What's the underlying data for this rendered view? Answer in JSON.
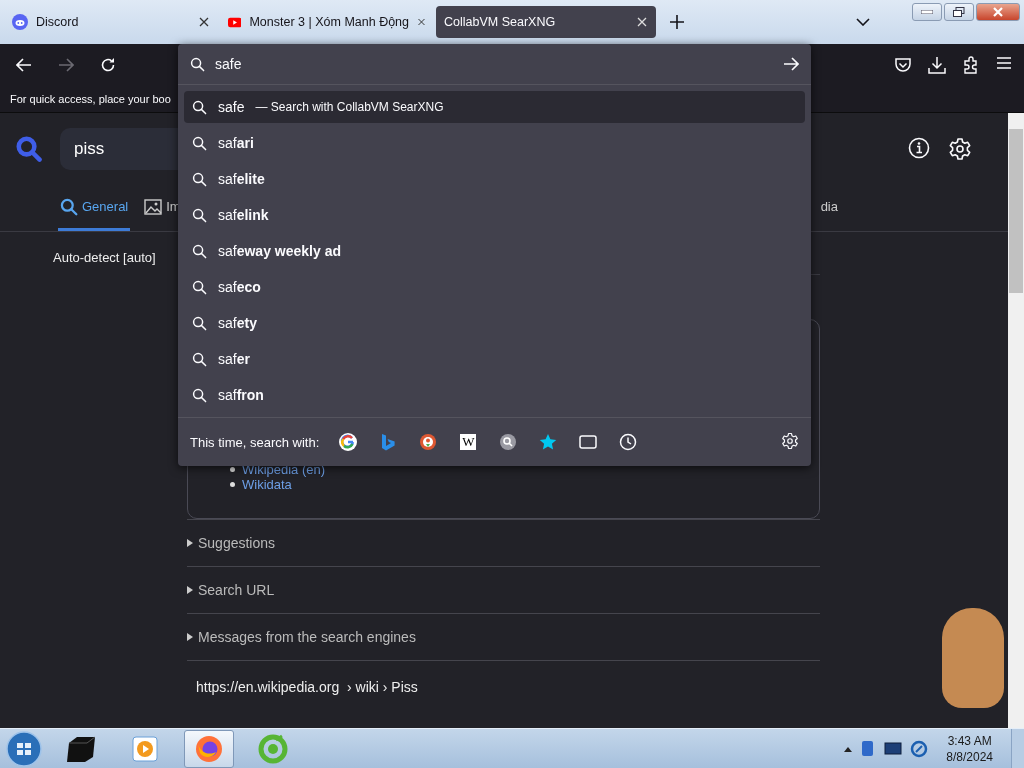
{
  "browser_tabs": [
    {
      "kind": "discord",
      "title": "Discord",
      "selected": false
    },
    {
      "kind": "video",
      "title": "Monster 3 | Xóm Manh Động",
      "selected": false
    },
    {
      "kind": "plain",
      "title": "CollabVM SearXNG",
      "selected": true
    }
  ],
  "bookmarks_bar": {
    "text": "For quick access, place your boo"
  },
  "address_dropdown": {
    "value": "safe",
    "suggestions": [
      {
        "text": "safe",
        "hint": "— Search with CollabVM SearXNG",
        "selected": true
      },
      {
        "text": "saf**ari**",
        "selected": false
      },
      {
        "text": "saf**elite**",
        "selected": false
      },
      {
        "text": "saf**elink**",
        "selected": false
      },
      {
        "text": "saf**eway weekly ad**",
        "selected": false
      },
      {
        "text": "saf**eco**",
        "selected": false
      },
      {
        "text": "saf**ety**",
        "selected": false
      },
      {
        "text": "saf**er**",
        "selected": false
      },
      {
        "text": "saf**fron**",
        "selected": false
      }
    ],
    "footer_label": "This time, search with:",
    "engines": [
      {
        "kind": "google"
      },
      {
        "kind": "bing"
      },
      {
        "kind": "duck"
      },
      {
        "kind": "wiki",
        "label": "W"
      },
      {
        "kind": "searx"
      },
      {
        "kind": "bookmarks"
      },
      {
        "kind": "tabs"
      },
      {
        "kind": "history"
      }
    ]
  },
  "page": {
    "search_value": "piss",
    "categories": [
      {
        "kind": "general",
        "label": "General",
        "selected": true
      },
      {
        "kind": "images",
        "label": "Im",
        "selected": false
      },
      {
        "kind": "plain",
        "label": "dia",
        "selected": false
      }
    ],
    "language": "Auto-detect [auto]",
    "infobox_links": [
      "Wikipedia (en)",
      "Wikidata"
    ],
    "sections": [
      "Suggestions",
      "Search URL",
      "Messages from the search engines"
    ],
    "result_url": "https://en.wikipedia.org  › wiki › Piss"
  },
  "taskbar": {
    "apps": [
      {
        "kind": "box",
        "selected": false
      },
      {
        "kind": "player",
        "selected": false
      },
      {
        "kind": "firefox",
        "selected": true
      },
      {
        "kind": "cleaner",
        "selected": false
      }
    ],
    "time": "3:43 AM",
    "date": "8/8/2024"
  }
}
